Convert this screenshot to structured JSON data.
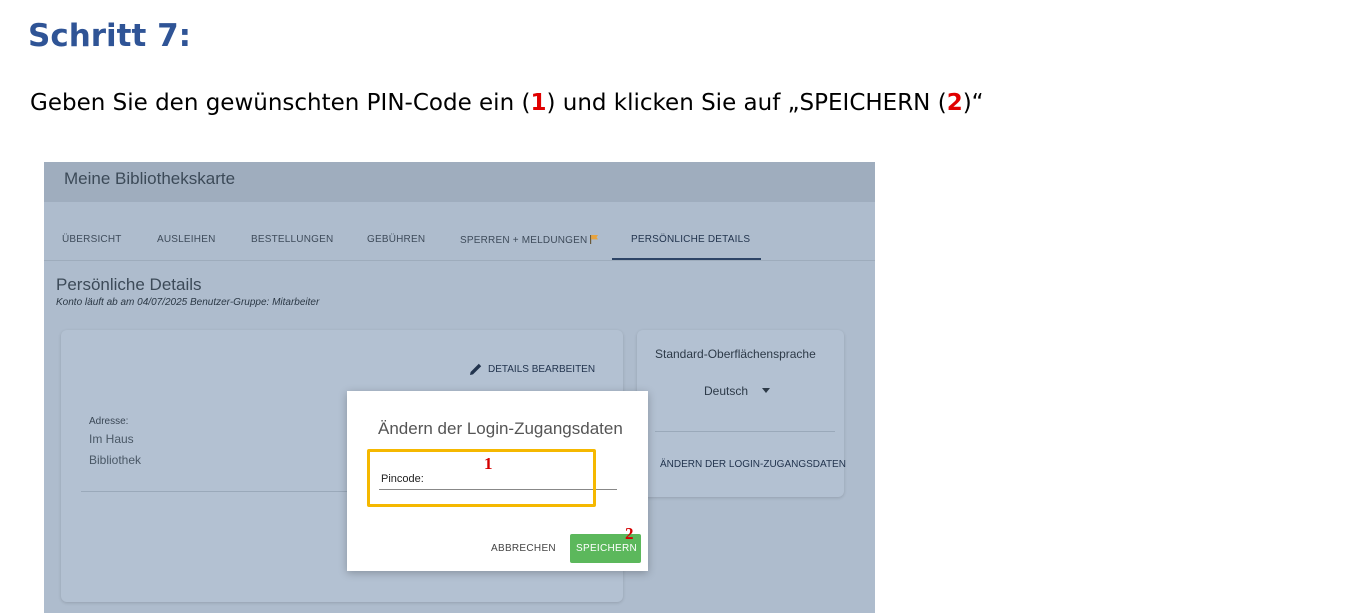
{
  "document": {
    "title": "Schritt 7:",
    "instruction": {
      "part1": "Geben Sie den gewünschten PIN-Code ein (",
      "mark1": "1",
      "part2": ") und klicken Sie auf „SPEICHERN (",
      "mark2": "2",
      "part3": ")“"
    }
  },
  "app": {
    "title": "Meine Bibliothekskarte",
    "tabs": [
      {
        "label": "ÜBERSICHT"
      },
      {
        "label": "AUSLEIHEN"
      },
      {
        "label": "BESTELLUNGEN"
      },
      {
        "label": "GEBÜHREN"
      },
      {
        "label": "SPERREN + MELDUNGEN"
      },
      {
        "label": "PERSÖNLICHE DETAILS",
        "active": true
      }
    ],
    "section": {
      "title": "Persönliche Details",
      "subtitle": "Konto läuft ab am 04/07/2025 Benutzer-Gruppe: Mitarbeiter"
    },
    "details_card": {
      "edit_label": "DETAILS BEARBEITEN",
      "address_label": "Adresse:",
      "address_lines": [
        "Im Haus",
        "Bibliothek"
      ]
    },
    "language_card": {
      "label": "Standard-Oberflächensprache",
      "selected": "Deutsch",
      "login_link": "ÄNDERN DER LOGIN-ZUGANGSDATEN"
    },
    "modal": {
      "title": "Ändern der Login-Zugangsdaten",
      "pin_label": "Pincode:",
      "pin_value": "",
      "cancel_label": "ABBRECHEN",
      "save_label": "SPEICHERN"
    },
    "markers": {
      "pin": "1",
      "save": "2"
    }
  },
  "colors": {
    "heading": "#2f5496",
    "marker": "#e00000",
    "highlight": "#f5b800",
    "save_button": "#5cb85c",
    "flag": "#e8a33d"
  }
}
